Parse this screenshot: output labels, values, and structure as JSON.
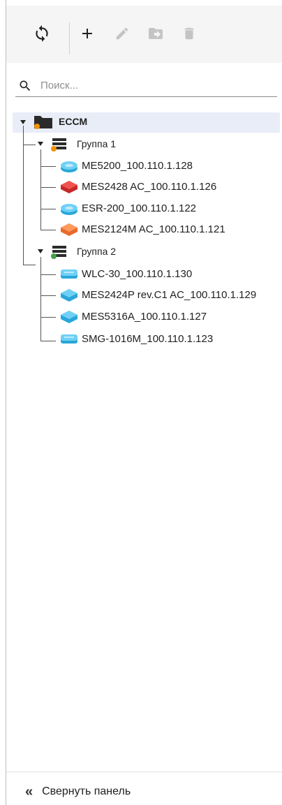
{
  "toolbar": {
    "refresh": "refresh-icon",
    "add": "plus-icon",
    "edit": "pencil-icon",
    "move": "move-to-folder-icon",
    "delete": "trash-icon"
  },
  "search": {
    "placeholder": "Поиск..."
  },
  "tree": {
    "root": {
      "label": "ECCM",
      "icon": "folder-icon"
    },
    "groups": [
      {
        "label": "Группа 1",
        "status_color": "#f39200",
        "devices": [
          {
            "label": "ME5200_100.110.1.128",
            "icon": "router-icon",
            "color": "#4fc3f7"
          },
          {
            "label": "MES2428 AC_100.110.1.126",
            "icon": "switch-icon",
            "color": "#e53935"
          },
          {
            "label": "ESR-200_100.110.1.122",
            "icon": "router-icon",
            "color": "#4fc3f7"
          },
          {
            "label": "MES2124M AC_100.110.1.121",
            "icon": "switch-icon",
            "color": "#ff8a4c"
          }
        ]
      },
      {
        "label": "Группа 2",
        "status_color": "#43a047",
        "devices": [
          {
            "label": "WLC-30_100.110.1.130",
            "icon": "wlc-icon",
            "color": "#4fc3f7"
          },
          {
            "label": "MES2424P rev.C1 AC_100.110.1.129",
            "icon": "switch-icon",
            "color": "#4fc3f7"
          },
          {
            "label": "MES5316A_100.110.1.127",
            "icon": "switch-icon",
            "color": "#4fc3f7"
          },
          {
            "label": "SMG-1016M_100.110.1.123",
            "icon": "wlc-icon",
            "color": "#4fc3f7"
          }
        ]
      }
    ]
  },
  "footer": {
    "collapse_label": "Свернуть панель",
    "collapse_icon": "«"
  }
}
